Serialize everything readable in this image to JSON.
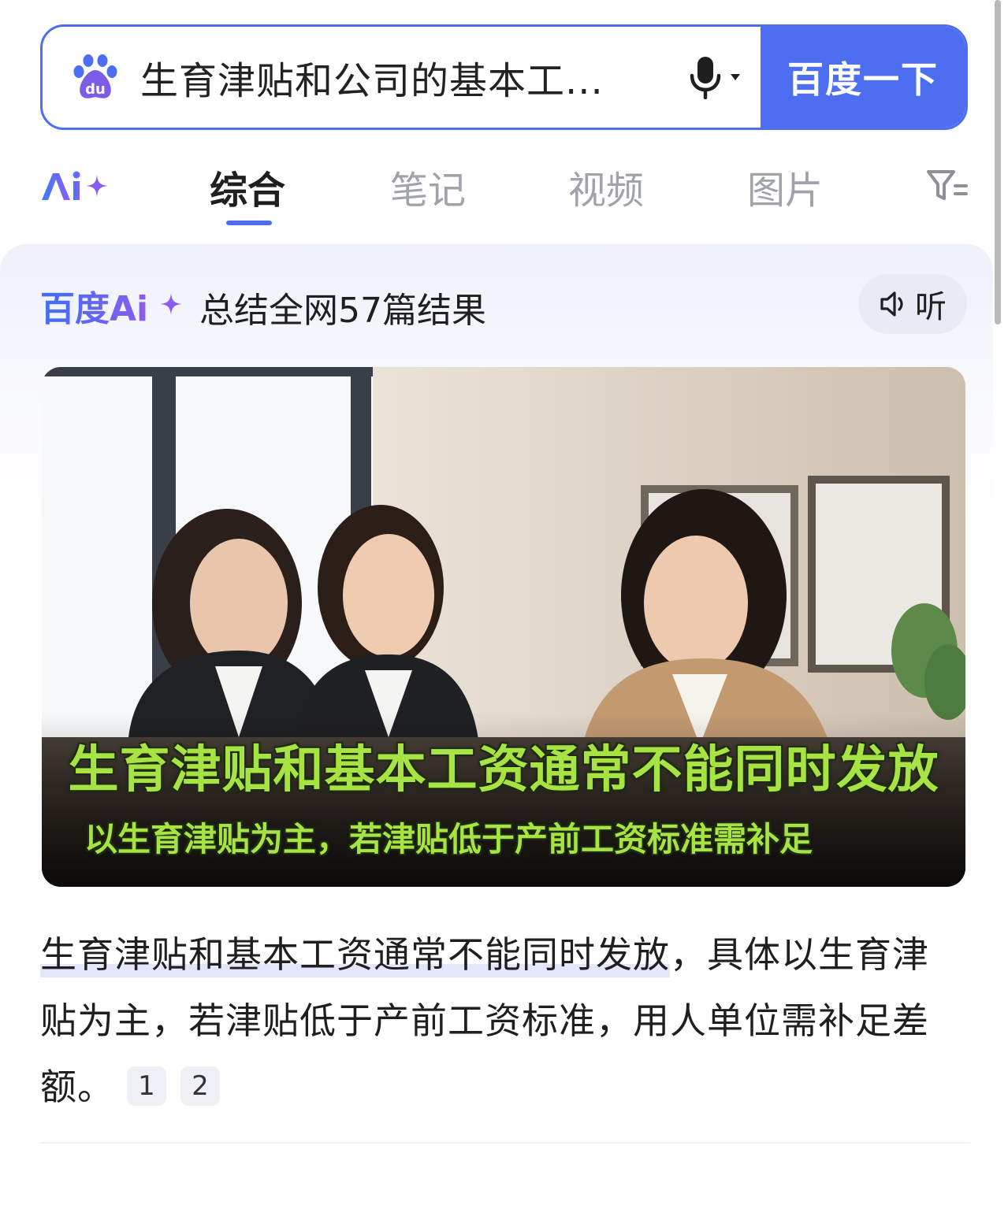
{
  "search": {
    "query": "生育津贴和公司的基本工...",
    "button_label": "百度一下",
    "logo_text": "du"
  },
  "tabs": {
    "items": [
      {
        "label": "综合",
        "active": true
      },
      {
        "label": "笔记",
        "active": false
      },
      {
        "label": "视频",
        "active": false
      },
      {
        "label": "图片",
        "active": false
      }
    ]
  },
  "ai_summary": {
    "logo": "百度Ai",
    "summary_text": "总结全网57篇结果",
    "listen_label": "听",
    "image": {
      "caption_main": "生育津贴和基本工资通常不能同时发放",
      "caption_sub": "以生育津贴为主，若津贴低于产前工资标准需补足"
    },
    "answer": {
      "highlight": "生育津贴和基本工资通常不能同时发放",
      "rest": "，具体以生育津贴为主，若津贴低于产前工资标准，用人单位需补足差额。",
      "citations": [
        "1",
        "2"
      ]
    }
  },
  "colors": {
    "brand_blue": "#4e6ef2",
    "caption_green": "#a7e342"
  }
}
